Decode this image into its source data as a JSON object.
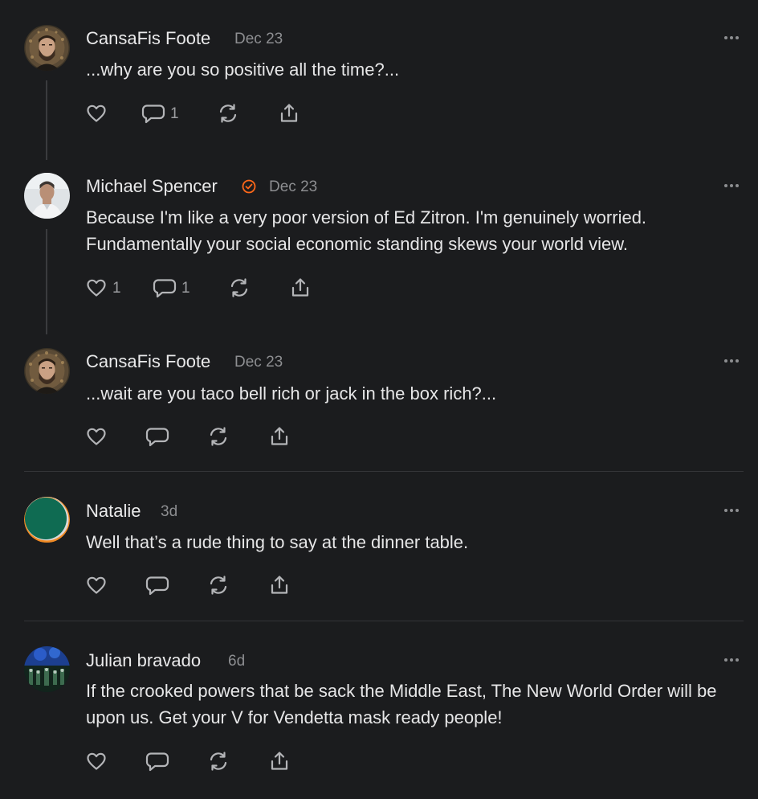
{
  "comments": [
    {
      "author": "CansaFis Foote",
      "date": "Dec 23",
      "text": "...why are you so positive all the time?...",
      "reply_count": "1",
      "like_count": ""
    },
    {
      "author": "Michael Spencer",
      "date": "Dec 23",
      "text": "Because I'm like a very poor version of Ed Zitron. I'm genuinely worried. Fundamentally your social economic standing skews your world view.",
      "reply_count": "1",
      "like_count": "1"
    },
    {
      "author": "CansaFis Foote",
      "date": "Dec 23",
      "text": "...wait are you taco bell rich or jack in the box rich?..."
    },
    {
      "author": "Natalie",
      "date": "3d",
      "text": "Well that’s a rude thing to say at the dinner table."
    },
    {
      "author": "Julian bravado",
      "date": "6d",
      "text": "If the crooked powers that be sack the Middle East, The New World Order will be upon us. Get your V for Vendetta mask ready people!"
    }
  ],
  "icons": {
    "like": "heart-icon",
    "reply": "comment-bubble-icon",
    "restack": "restack-icon",
    "share": "share-icon",
    "more": "more-options-icon",
    "verified": "verified-badge-icon"
  },
  "colors": {
    "background": "#1b1c1e",
    "text": "#e9e9ea",
    "muted": "#8d8e91",
    "verified_accent": "#ff6719",
    "natalie_avatar_green": "#0f6b52",
    "natalie_avatar_orange": "#f08a24"
  }
}
